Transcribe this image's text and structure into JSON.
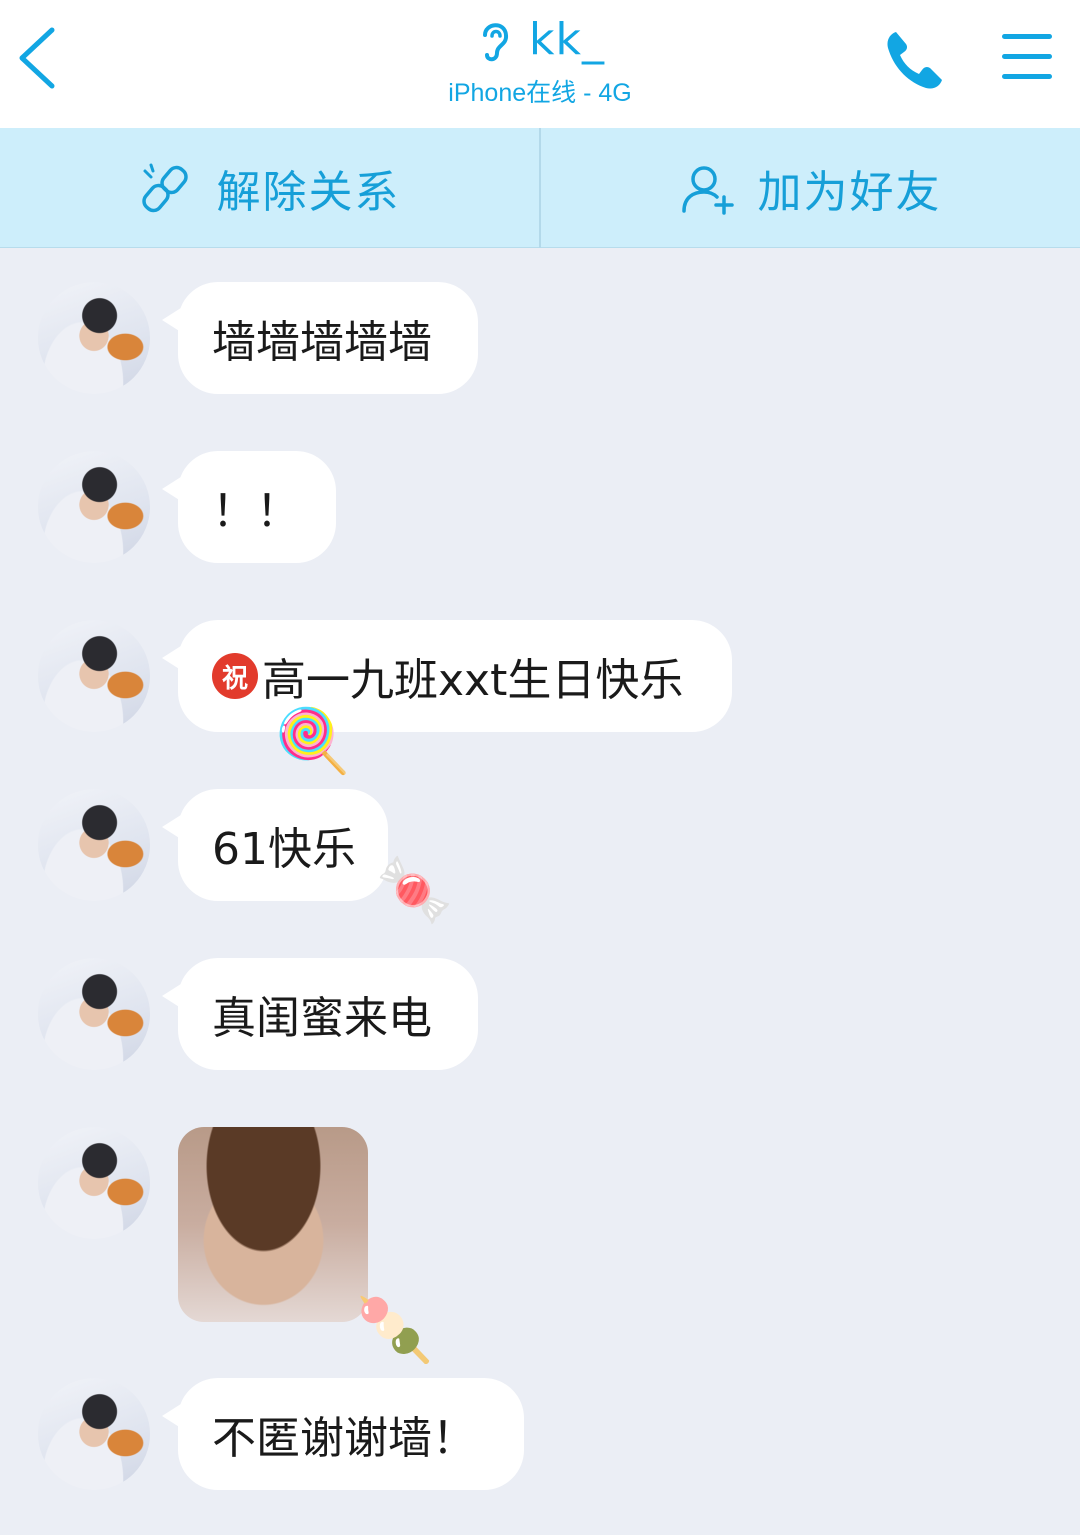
{
  "header": {
    "title": "kk_",
    "status": "iPhone在线 - 4G"
  },
  "actions": {
    "unlink_label": "解除关系",
    "add_friend_label": "加为好友"
  },
  "messages": [
    {
      "type": "text",
      "text": "墙墙墙墙墙"
    },
    {
      "type": "text",
      "text": "！！"
    },
    {
      "type": "text",
      "badge": "祝",
      "text": "高一九班xxt生日快乐",
      "sticker": "🍭"
    },
    {
      "type": "text",
      "text": "61快乐",
      "sticker": "🍬"
    },
    {
      "type": "text",
      "text": "真闺蜜来电"
    },
    {
      "type": "image",
      "sticker": "🍡"
    },
    {
      "type": "text",
      "text": "不匿谢谢墙！"
    }
  ],
  "colors": {
    "accent": "#12a6e3",
    "action_bar_bg": "#cdeefb",
    "chat_bg": "#ebeef5",
    "bubble_bg": "#ffffff"
  },
  "icons": [
    "back-arrow-icon",
    "ear-icon",
    "phone-icon",
    "menu-icon",
    "unlink-icon",
    "add-friend-icon"
  ]
}
